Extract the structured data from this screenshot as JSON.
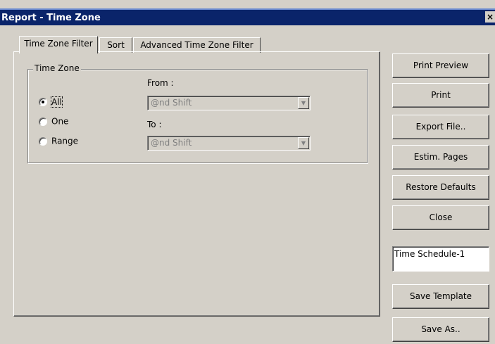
{
  "window": {
    "title": "Report  - Time Zone",
    "close_glyph": "×"
  },
  "tabs": [
    {
      "label": "Time Zone Filter"
    },
    {
      "label": "Sort"
    },
    {
      "label": "Advanced Time Zone Filter"
    }
  ],
  "group": {
    "label": "Time Zone",
    "options": [
      {
        "label": "All",
        "checked": true
      },
      {
        "label": "One",
        "checked": false
      },
      {
        "label": "Range",
        "checked": false
      }
    ],
    "from": {
      "label": "From :",
      "value": "@nd Shift"
    },
    "to": {
      "label": "To :",
      "value": "@nd Shift"
    }
  },
  "buttons": {
    "print_preview": "Print Preview",
    "print": "Print",
    "export_file": "Export File..",
    "estim_pages": "Estim. Pages",
    "restore_defaults": "Restore Defaults",
    "close": "Close",
    "save_template": "Save Template",
    "save_as": "Save As.."
  },
  "template_name": {
    "value": "Time Schedule-1"
  }
}
